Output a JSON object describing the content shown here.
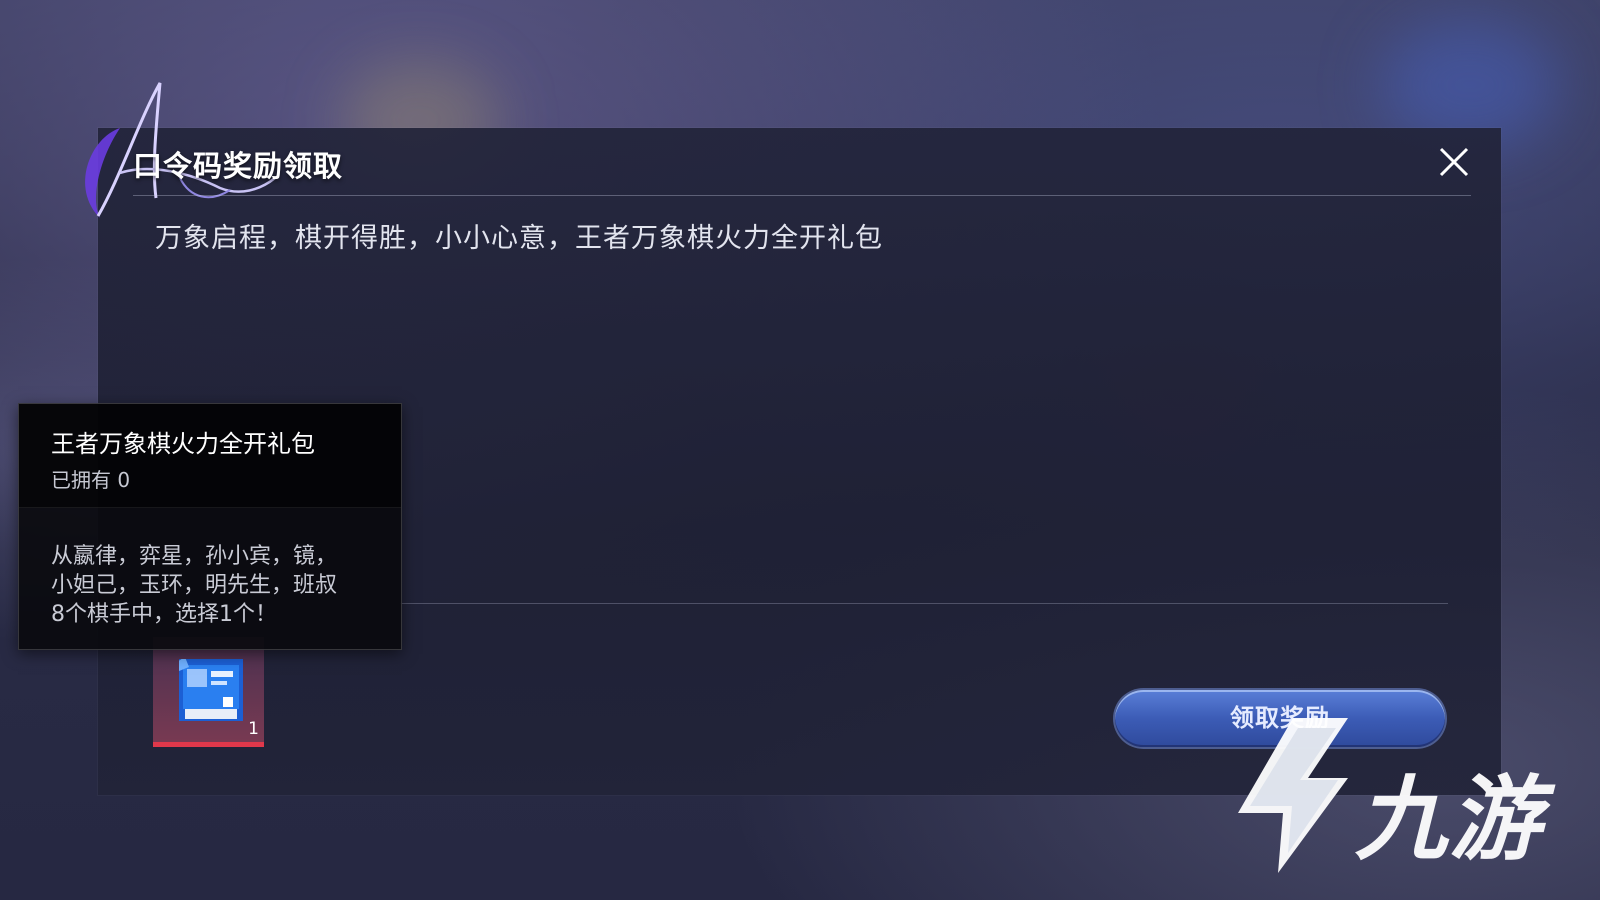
{
  "dialog": {
    "title": "口令码奖励领取",
    "message": "万象启程，棋开得胜，小小心意，王者万象棋火力全开礼包",
    "close_icon": "close-icon"
  },
  "tooltip": {
    "item_name": "王者万象棋火力全开礼包",
    "owned": "已拥有 0",
    "description": "从嬴律，弈星，孙小宾，镜，\n小妲己，玉环，明先生，班叔\n8个棋手中，选择1个！"
  },
  "reward": {
    "count": "1",
    "icon": "gift-pack-icon"
  },
  "claim_button": {
    "label": "领取奖励"
  },
  "watermark": {
    "text": "九游",
    "logo": "jiuyou-logo"
  },
  "colors": {
    "accent_blue": "#3c5cb6",
    "rarity_red": "#e0384b",
    "dialog_bg": "#22243a"
  }
}
